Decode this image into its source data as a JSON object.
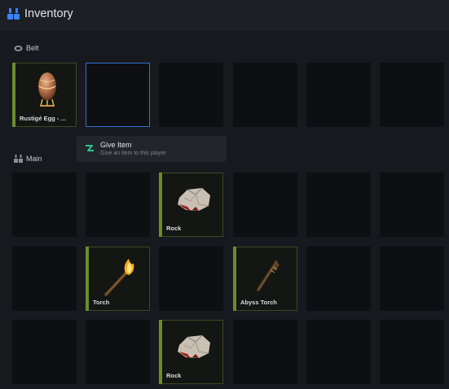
{
  "header": {
    "title": "Inventory",
    "icon": "inventory-icon"
  },
  "sections": {
    "belt": {
      "label": "Belt",
      "icon": "belt-icon"
    },
    "main": {
      "label": "Main",
      "icon": "main-icon"
    }
  },
  "belt_slots": [
    {
      "item": "Rustigé Egg - ...",
      "icon": "egg-icon"
    },
    {
      "item": "",
      "selected": true
    },
    {
      "item": ""
    },
    {
      "item": ""
    },
    {
      "item": ""
    },
    {
      "item": ""
    }
  ],
  "main_slots": [
    {
      "item": ""
    },
    {
      "item": ""
    },
    {
      "item": "Rock",
      "icon": "rock-icon"
    },
    {
      "item": ""
    },
    {
      "item": ""
    },
    {
      "item": ""
    },
    {
      "item": ""
    },
    {
      "item": "Torch",
      "icon": "torch-icon"
    },
    {
      "item": ""
    },
    {
      "item": "Abyss Torch",
      "icon": "abyss-torch-icon"
    },
    {
      "item": ""
    },
    {
      "item": ""
    },
    {
      "item": ""
    },
    {
      "item": ""
    },
    {
      "item": "Rock",
      "icon": "rock-icon"
    },
    {
      "item": ""
    },
    {
      "item": ""
    },
    {
      "item": ""
    }
  ],
  "tooltip": {
    "title": "Give Item",
    "subtitle": "Give an item to this player",
    "icon": "give-item-icon"
  },
  "colors": {
    "background": "#16191e",
    "header": "#1c1f24",
    "slot": "#0d0f12",
    "filled_accent": "#6c8c2a",
    "selected_border": "#3570d6",
    "tooltip_icon": "#2fbf8a",
    "logo": "#3b82f6"
  }
}
